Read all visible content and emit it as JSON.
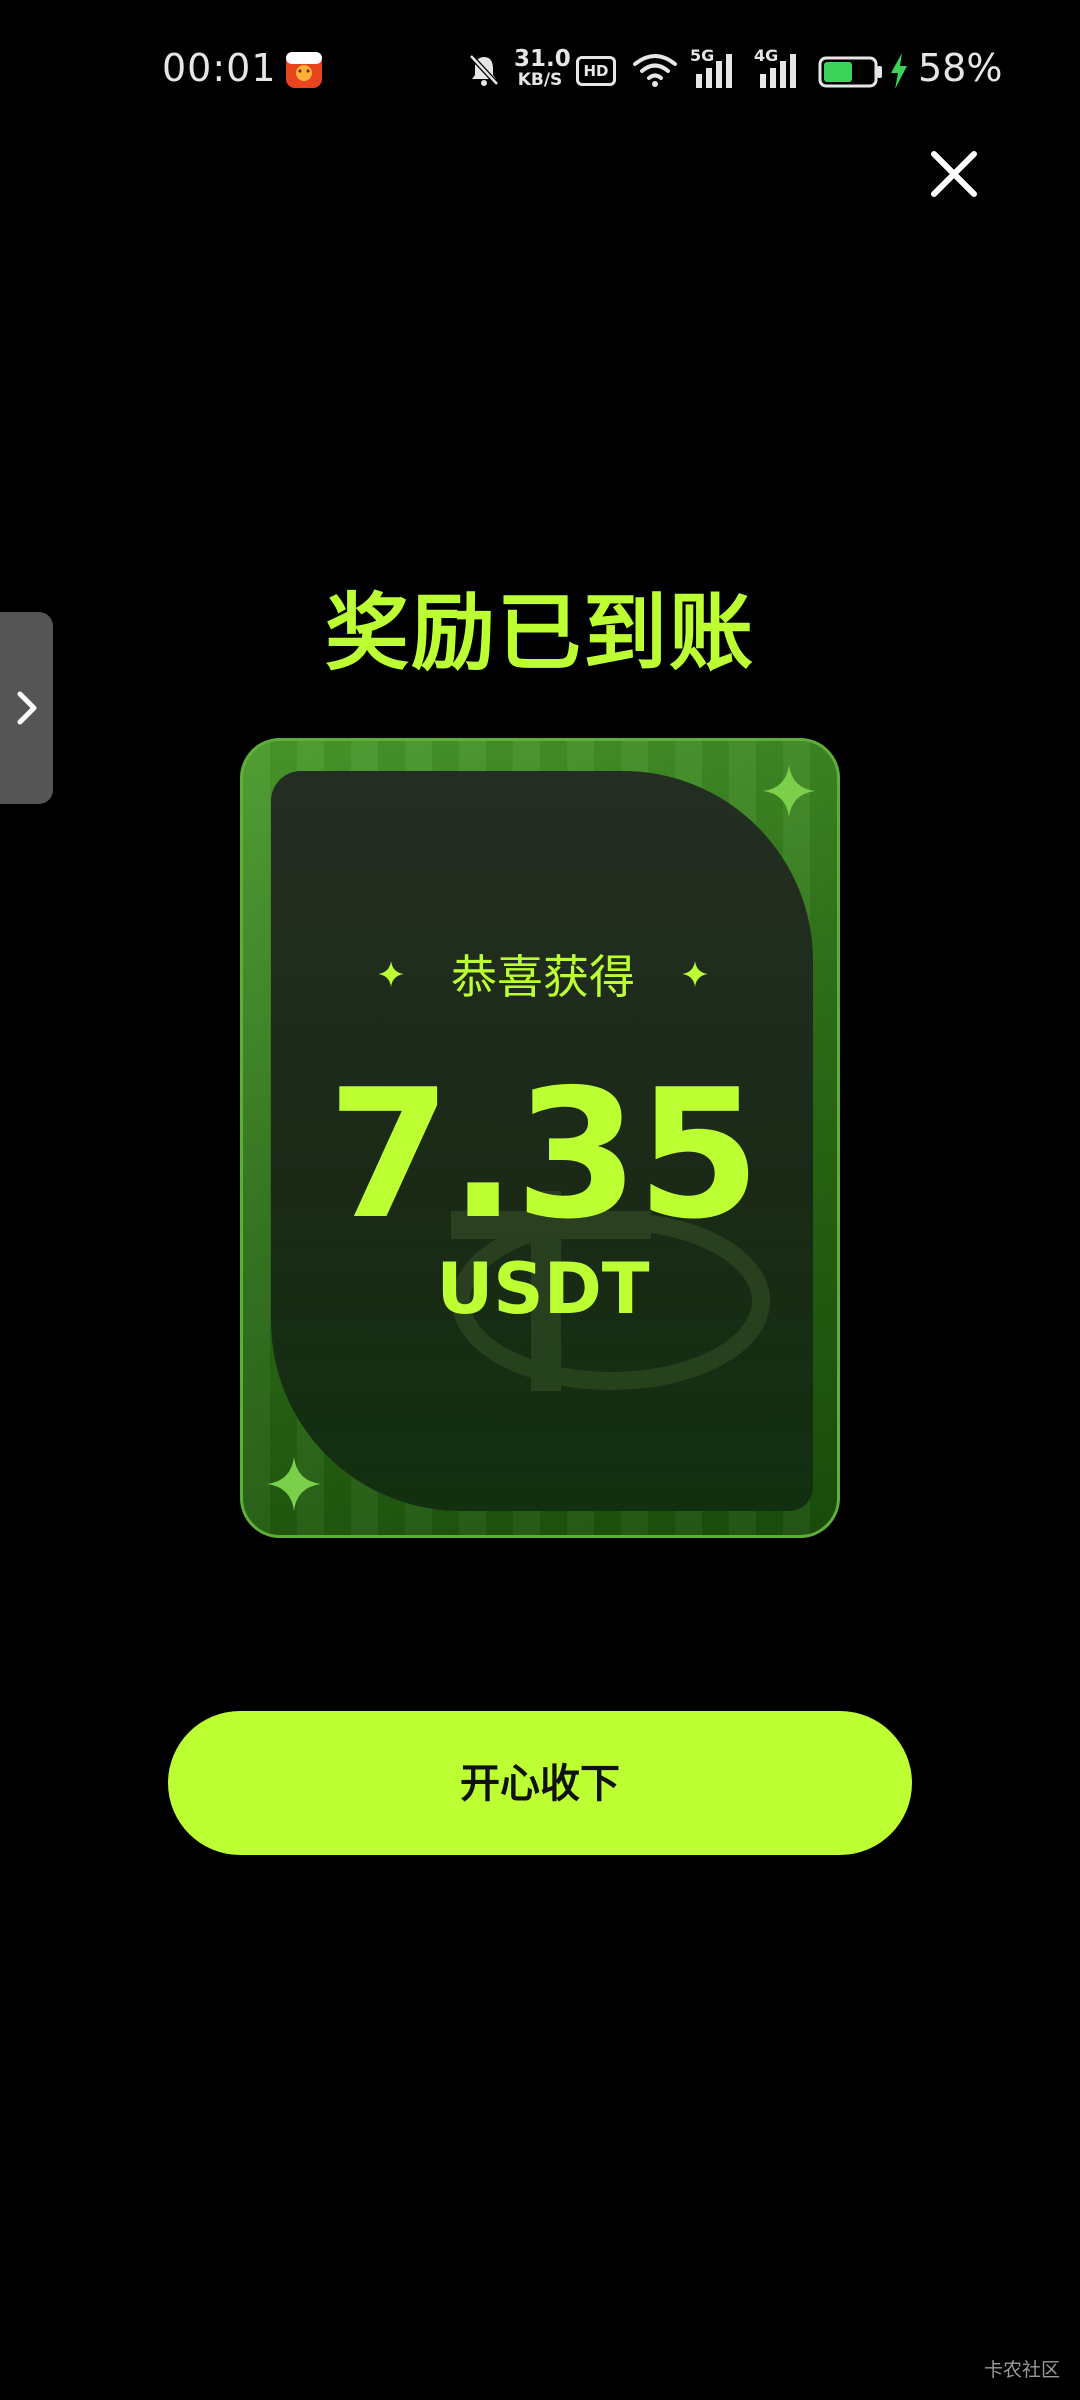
{
  "status_bar": {
    "time": "00:01",
    "net_speed_value": "31.0",
    "net_speed_unit": "KB/S",
    "hd_label": "HD",
    "signal_1_label": "5G",
    "signal_2_label": "4G",
    "battery_percent": "58%",
    "battery_level": 0.58,
    "battery_color": "#3cd35a",
    "icons": [
      "app-notification-icon",
      "muted-bell-icon",
      "hd-icon",
      "wifi-icon",
      "signal-5g-icon",
      "signal-4g-icon",
      "battery-icon",
      "charging-bolt-icon"
    ]
  },
  "dialog": {
    "title": "奖励已到账",
    "card": {
      "subtitle": "恭喜获得",
      "amount": "7.35",
      "currency": "USDT"
    },
    "accept_button_label": "开心收下",
    "close_icon": "close-icon",
    "side_tab_icon": "chevron-right-icon"
  },
  "watermark": "卡农社区",
  "colors": {
    "accent": "#bcff32",
    "background": "#000000",
    "card_green": "#2c6d17"
  }
}
